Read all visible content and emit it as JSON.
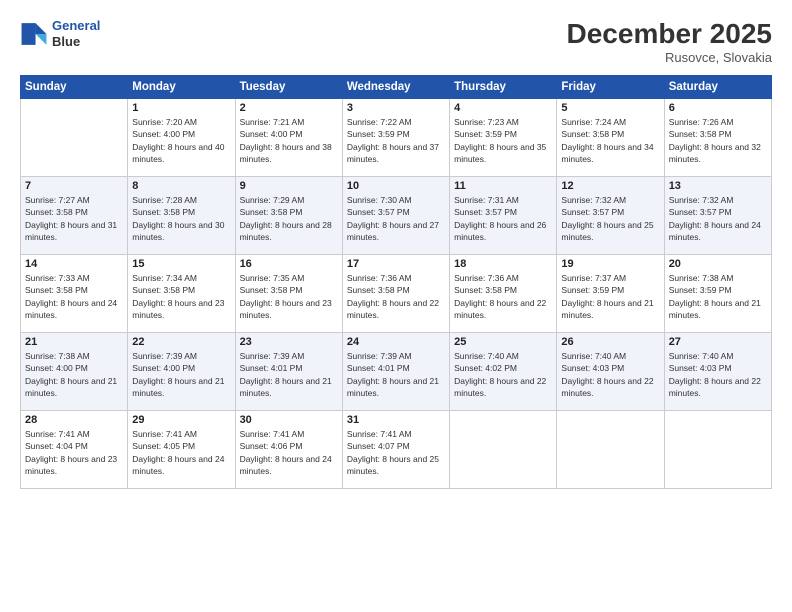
{
  "logo": {
    "line1": "General",
    "line2": "Blue"
  },
  "title": "December 2025",
  "subtitle": "Rusovce, Slovakia",
  "weekdays": [
    "Sunday",
    "Monday",
    "Tuesday",
    "Wednesday",
    "Thursday",
    "Friday",
    "Saturday"
  ],
  "weeks": [
    [
      {
        "day": "",
        "sunrise": "",
        "sunset": "",
        "daylight": ""
      },
      {
        "day": "1",
        "sunrise": "Sunrise: 7:20 AM",
        "sunset": "Sunset: 4:00 PM",
        "daylight": "Daylight: 8 hours and 40 minutes."
      },
      {
        "day": "2",
        "sunrise": "Sunrise: 7:21 AM",
        "sunset": "Sunset: 4:00 PM",
        "daylight": "Daylight: 8 hours and 38 minutes."
      },
      {
        "day": "3",
        "sunrise": "Sunrise: 7:22 AM",
        "sunset": "Sunset: 3:59 PM",
        "daylight": "Daylight: 8 hours and 37 minutes."
      },
      {
        "day": "4",
        "sunrise": "Sunrise: 7:23 AM",
        "sunset": "Sunset: 3:59 PM",
        "daylight": "Daylight: 8 hours and 35 minutes."
      },
      {
        "day": "5",
        "sunrise": "Sunrise: 7:24 AM",
        "sunset": "Sunset: 3:58 PM",
        "daylight": "Daylight: 8 hours and 34 minutes."
      },
      {
        "day": "6",
        "sunrise": "Sunrise: 7:26 AM",
        "sunset": "Sunset: 3:58 PM",
        "daylight": "Daylight: 8 hours and 32 minutes."
      }
    ],
    [
      {
        "day": "7",
        "sunrise": "Sunrise: 7:27 AM",
        "sunset": "Sunset: 3:58 PM",
        "daylight": "Daylight: 8 hours and 31 minutes."
      },
      {
        "day": "8",
        "sunrise": "Sunrise: 7:28 AM",
        "sunset": "Sunset: 3:58 PM",
        "daylight": "Daylight: 8 hours and 30 minutes."
      },
      {
        "day": "9",
        "sunrise": "Sunrise: 7:29 AM",
        "sunset": "Sunset: 3:58 PM",
        "daylight": "Daylight: 8 hours and 28 minutes."
      },
      {
        "day": "10",
        "sunrise": "Sunrise: 7:30 AM",
        "sunset": "Sunset: 3:57 PM",
        "daylight": "Daylight: 8 hours and 27 minutes."
      },
      {
        "day": "11",
        "sunrise": "Sunrise: 7:31 AM",
        "sunset": "Sunset: 3:57 PM",
        "daylight": "Daylight: 8 hours and 26 minutes."
      },
      {
        "day": "12",
        "sunrise": "Sunrise: 7:32 AM",
        "sunset": "Sunset: 3:57 PM",
        "daylight": "Daylight: 8 hours and 25 minutes."
      },
      {
        "day": "13",
        "sunrise": "Sunrise: 7:32 AM",
        "sunset": "Sunset: 3:57 PM",
        "daylight": "Daylight: 8 hours and 24 minutes."
      }
    ],
    [
      {
        "day": "14",
        "sunrise": "Sunrise: 7:33 AM",
        "sunset": "Sunset: 3:58 PM",
        "daylight": "Daylight: 8 hours and 24 minutes."
      },
      {
        "day": "15",
        "sunrise": "Sunrise: 7:34 AM",
        "sunset": "Sunset: 3:58 PM",
        "daylight": "Daylight: 8 hours and 23 minutes."
      },
      {
        "day": "16",
        "sunrise": "Sunrise: 7:35 AM",
        "sunset": "Sunset: 3:58 PM",
        "daylight": "Daylight: 8 hours and 23 minutes."
      },
      {
        "day": "17",
        "sunrise": "Sunrise: 7:36 AM",
        "sunset": "Sunset: 3:58 PM",
        "daylight": "Daylight: 8 hours and 22 minutes."
      },
      {
        "day": "18",
        "sunrise": "Sunrise: 7:36 AM",
        "sunset": "Sunset: 3:58 PM",
        "daylight": "Daylight: 8 hours and 22 minutes."
      },
      {
        "day": "19",
        "sunrise": "Sunrise: 7:37 AM",
        "sunset": "Sunset: 3:59 PM",
        "daylight": "Daylight: 8 hours and 21 minutes."
      },
      {
        "day": "20",
        "sunrise": "Sunrise: 7:38 AM",
        "sunset": "Sunset: 3:59 PM",
        "daylight": "Daylight: 8 hours and 21 minutes."
      }
    ],
    [
      {
        "day": "21",
        "sunrise": "Sunrise: 7:38 AM",
        "sunset": "Sunset: 4:00 PM",
        "daylight": "Daylight: 8 hours and 21 minutes."
      },
      {
        "day": "22",
        "sunrise": "Sunrise: 7:39 AM",
        "sunset": "Sunset: 4:00 PM",
        "daylight": "Daylight: 8 hours and 21 minutes."
      },
      {
        "day": "23",
        "sunrise": "Sunrise: 7:39 AM",
        "sunset": "Sunset: 4:01 PM",
        "daylight": "Daylight: 8 hours and 21 minutes."
      },
      {
        "day": "24",
        "sunrise": "Sunrise: 7:39 AM",
        "sunset": "Sunset: 4:01 PM",
        "daylight": "Daylight: 8 hours and 21 minutes."
      },
      {
        "day": "25",
        "sunrise": "Sunrise: 7:40 AM",
        "sunset": "Sunset: 4:02 PM",
        "daylight": "Daylight: 8 hours and 22 minutes."
      },
      {
        "day": "26",
        "sunrise": "Sunrise: 7:40 AM",
        "sunset": "Sunset: 4:03 PM",
        "daylight": "Daylight: 8 hours and 22 minutes."
      },
      {
        "day": "27",
        "sunrise": "Sunrise: 7:40 AM",
        "sunset": "Sunset: 4:03 PM",
        "daylight": "Daylight: 8 hours and 22 minutes."
      }
    ],
    [
      {
        "day": "28",
        "sunrise": "Sunrise: 7:41 AM",
        "sunset": "Sunset: 4:04 PM",
        "daylight": "Daylight: 8 hours and 23 minutes."
      },
      {
        "day": "29",
        "sunrise": "Sunrise: 7:41 AM",
        "sunset": "Sunset: 4:05 PM",
        "daylight": "Daylight: 8 hours and 24 minutes."
      },
      {
        "day": "30",
        "sunrise": "Sunrise: 7:41 AM",
        "sunset": "Sunset: 4:06 PM",
        "daylight": "Daylight: 8 hours and 24 minutes."
      },
      {
        "day": "31",
        "sunrise": "Sunrise: 7:41 AM",
        "sunset": "Sunset: 4:07 PM",
        "daylight": "Daylight: 8 hours and 25 minutes."
      },
      {
        "day": "",
        "sunrise": "",
        "sunset": "",
        "daylight": ""
      },
      {
        "day": "",
        "sunrise": "",
        "sunset": "",
        "daylight": ""
      },
      {
        "day": "",
        "sunrise": "",
        "sunset": "",
        "daylight": ""
      }
    ]
  ]
}
